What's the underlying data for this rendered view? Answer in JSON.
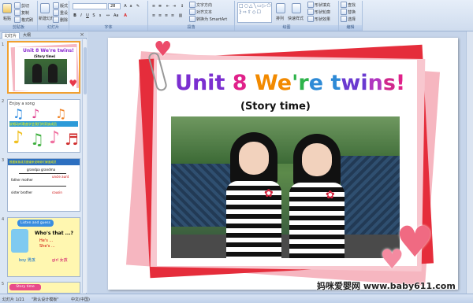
{
  "ribbon": {
    "groups": [
      {
        "label": "剪贴板"
      },
      {
        "label": "幻灯片"
      },
      {
        "label": "字体"
      },
      {
        "label": "段落"
      },
      {
        "label": "绘图"
      },
      {
        "label": "编辑"
      }
    ],
    "clipboard": {
      "paste": "粘贴",
      "cut": "剪切",
      "copy": "复制",
      "format_painter": "格式刷"
    },
    "slides": {
      "new_slide": "新建幻灯片",
      "layout": "版式",
      "reset": "重设",
      "delete": "删除"
    },
    "font": {
      "size": "28"
    },
    "paragraph": {
      "text_direction": "文字方向",
      "align_text": "对齐文本",
      "smartart": "转换为 SmartArt"
    },
    "drawing": {
      "arrange": "排列",
      "quick_styles": "快速样式",
      "shape_fill": "形状填充",
      "shape_outline": "形状轮廓",
      "shape_effects": "形状效果"
    },
    "editing": {
      "find": "查找",
      "replace": "替换",
      "select": "选择"
    }
  },
  "panel": {
    "tabs": [
      "幻灯片",
      "大纲"
    ],
    "close": "×",
    "slides": [
      {
        "num": "1",
        "title": "Unit 8 We're twins!",
        "subtitle": "(Story time)"
      },
      {
        "num": "2",
        "title": "Enjoy a song",
        "caption": "说唱动听歌曲学会我们的家族成员"
      },
      {
        "num": "3",
        "title": "根据家族成员图谱来说明你们家庭成员",
        "words": [
          "grandpa",
          "grandma",
          "father",
          "mother",
          "uncle",
          "aunt",
          "sister",
          "brother",
          "cousin"
        ]
      },
      {
        "num": "4",
        "title": "Listen and guess",
        "question": "Who's that ...?",
        "lines": [
          "He's ...",
          "She's ..."
        ],
        "boy": "boy 男孩",
        "girl": "girl 女孩"
      },
      {
        "num": "5",
        "title": "Story time"
      }
    ]
  },
  "slide": {
    "title_chars": [
      {
        "ch": "U",
        "color": "#7b2fd0"
      },
      {
        "ch": "n",
        "color": "#7b2fd0"
      },
      {
        "ch": "i",
        "color": "#7b2fd0"
      },
      {
        "ch": "t",
        "color": "#7b2fd0"
      },
      {
        "ch": " ",
        "color": "#000000"
      },
      {
        "ch": "8",
        "color": "#e0218a"
      },
      {
        "ch": " ",
        "color": "#000000"
      },
      {
        "ch": "W",
        "color": "#f28a00"
      },
      {
        "ch": "e",
        "color": "#f28a00"
      },
      {
        "ch": "'",
        "color": "#2db34a"
      },
      {
        "ch": "r",
        "color": "#2db34a"
      },
      {
        "ch": "e",
        "color": "#2e8ad6"
      },
      {
        "ch": " ",
        "color": "#000000"
      },
      {
        "ch": "t",
        "color": "#2e8ad6"
      },
      {
        "ch": "w",
        "color": "#6a3ad0"
      },
      {
        "ch": "i",
        "color": "#6a3ad0"
      },
      {
        "ch": "n",
        "color": "#b036c0"
      },
      {
        "ch": "s",
        "color": "#d0288c"
      },
      {
        "ch": "!",
        "color": "#e0218a"
      }
    ],
    "subtitle": "(Story time)"
  },
  "status": {
    "slide_count": "幻灯片 1/21",
    "theme": "\"默认设计模板\"",
    "language": "中文(中国)"
  },
  "watermark": "妈咪爱婴网 www.baby611.com",
  "colors": {
    "frame_pink": "#f4a8b4",
    "frame_red": "#e52d3b",
    "ribbon_blue": "#cfdcee",
    "selection_orange": "#f0a030"
  }
}
